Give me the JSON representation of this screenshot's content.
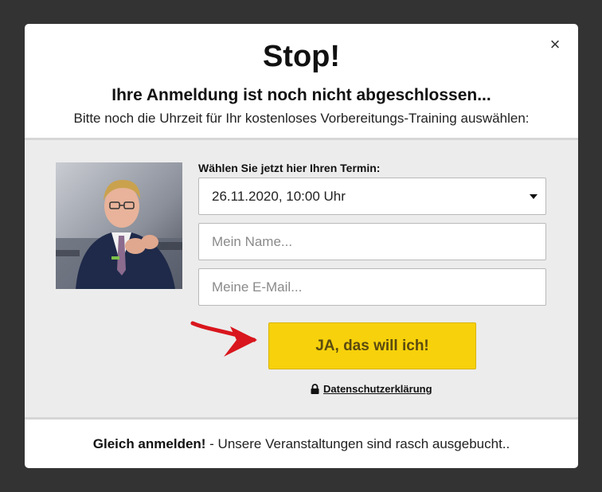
{
  "modal": {
    "close_label": "×",
    "title": "Stop!",
    "subtitle": "Ihre Anmeldung ist noch nicht abgeschlossen...",
    "description": "Bitte noch die Uhrzeit für Ihr kostenloses Vorbereitungs-Training auswählen:"
  },
  "form": {
    "label": "Wählen Sie jetzt hier Ihren Termin:",
    "date_select_value": "26.11.2020, 10:00 Uhr",
    "name_placeholder": "Mein Name...",
    "email_placeholder": "Meine E-Mail...",
    "submit_label": "JA, das will ich!",
    "privacy_link": "Datenschutzerklärung"
  },
  "footer": {
    "bold_text": "Gleich anmelden!",
    "text": " - Unsere Veranstaltungen sind rasch ausgebucht.."
  },
  "colors": {
    "overlay": "#333333",
    "cta_background": "#f7d10b",
    "cta_text": "#5b4b10",
    "arrow": "#d9161d",
    "body_background": "#ececec"
  },
  "icons": [
    "close-icon",
    "caret-down-icon",
    "red-arrow-icon",
    "lock-icon"
  ]
}
